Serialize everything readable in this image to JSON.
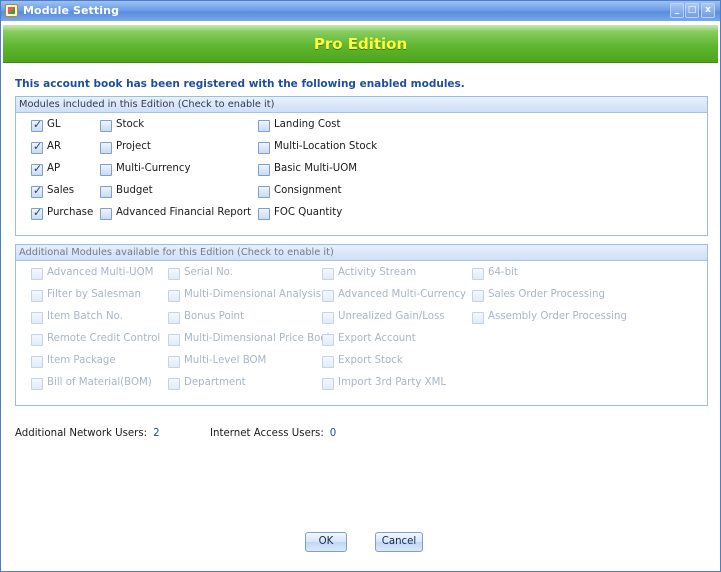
{
  "window": {
    "title": "Module Setting",
    "controls": {
      "minimize": "_",
      "maximize": "□",
      "close": "x"
    }
  },
  "banner": {
    "edition": "Pro Edition"
  },
  "registration_note": "This account book has been registered with the following enabled modules.",
  "included": {
    "header": "Modules included in this Edition (Check to enable it)",
    "columns": [
      [
        {
          "label": "GL",
          "checked": true
        },
        {
          "label": "AR",
          "checked": true
        },
        {
          "label": "AP",
          "checked": true
        },
        {
          "label": "Sales",
          "checked": true
        },
        {
          "label": "Purchase",
          "checked": true
        }
      ],
      [
        {
          "label": "Stock",
          "checked": false
        },
        {
          "label": "Project",
          "checked": false
        },
        {
          "label": "Multi-Currency",
          "checked": false
        },
        {
          "label": "Budget",
          "checked": false
        },
        {
          "label": "Advanced Financial Report",
          "checked": false
        }
      ],
      [
        {
          "label": "Landing Cost",
          "checked": false
        },
        {
          "label": "Multi-Location Stock",
          "checked": false
        },
        {
          "label": "Basic Multi-UOM",
          "checked": false
        },
        {
          "label": "Consignment",
          "checked": false
        },
        {
          "label": "FOC Quantity",
          "checked": false
        }
      ]
    ]
  },
  "additional": {
    "header": "Additional Modules available for this Edition (Check to enable it)",
    "columns": [
      [
        {
          "label": "Advanced Multi-UOM",
          "checked": false
        },
        {
          "label": "Filter by Salesman",
          "checked": false
        },
        {
          "label": "Item Batch No.",
          "checked": false
        },
        {
          "label": "Remote Credit Control",
          "checked": false
        },
        {
          "label": "Item Package",
          "checked": false
        },
        {
          "label": "Bill of Material(BOM)",
          "checked": false
        }
      ],
      [
        {
          "label": "Serial No.",
          "checked": false
        },
        {
          "label": "Multi-Dimensional Analysis",
          "checked": false
        },
        {
          "label": "Bonus Point",
          "checked": false
        },
        {
          "label": "Multi-Dimensional Price Book",
          "checked": false
        },
        {
          "label": "Multi-Level BOM",
          "checked": false
        },
        {
          "label": "Department",
          "checked": false
        }
      ],
      [
        {
          "label": "Activity Stream",
          "checked": false
        },
        {
          "label": "Advanced Multi-Currency",
          "checked": false
        },
        {
          "label": "Unrealized Gain/Loss",
          "checked": false
        },
        {
          "label": "Export Account",
          "checked": false
        },
        {
          "label": "Export Stock",
          "checked": false
        },
        {
          "label": "Import 3rd Party XML",
          "checked": false
        }
      ],
      [
        {
          "label": "64-bit",
          "checked": false
        },
        {
          "label": "Sales Order Processing",
          "checked": false
        },
        {
          "label": "Assembly Order Processing",
          "checked": false
        }
      ]
    ]
  },
  "users": {
    "network_label": "Additional Network Users:",
    "network_value": "2",
    "internet_label": "Internet Access Users:",
    "internet_value": "0"
  },
  "buttons": {
    "ok": "OK",
    "cancel": "Cancel"
  },
  "colors": {
    "title_bar": "#6f9ee7",
    "banner_green": "#60b732",
    "edition_text": "#fffb3f",
    "link_blue": "#1f4e9c"
  }
}
